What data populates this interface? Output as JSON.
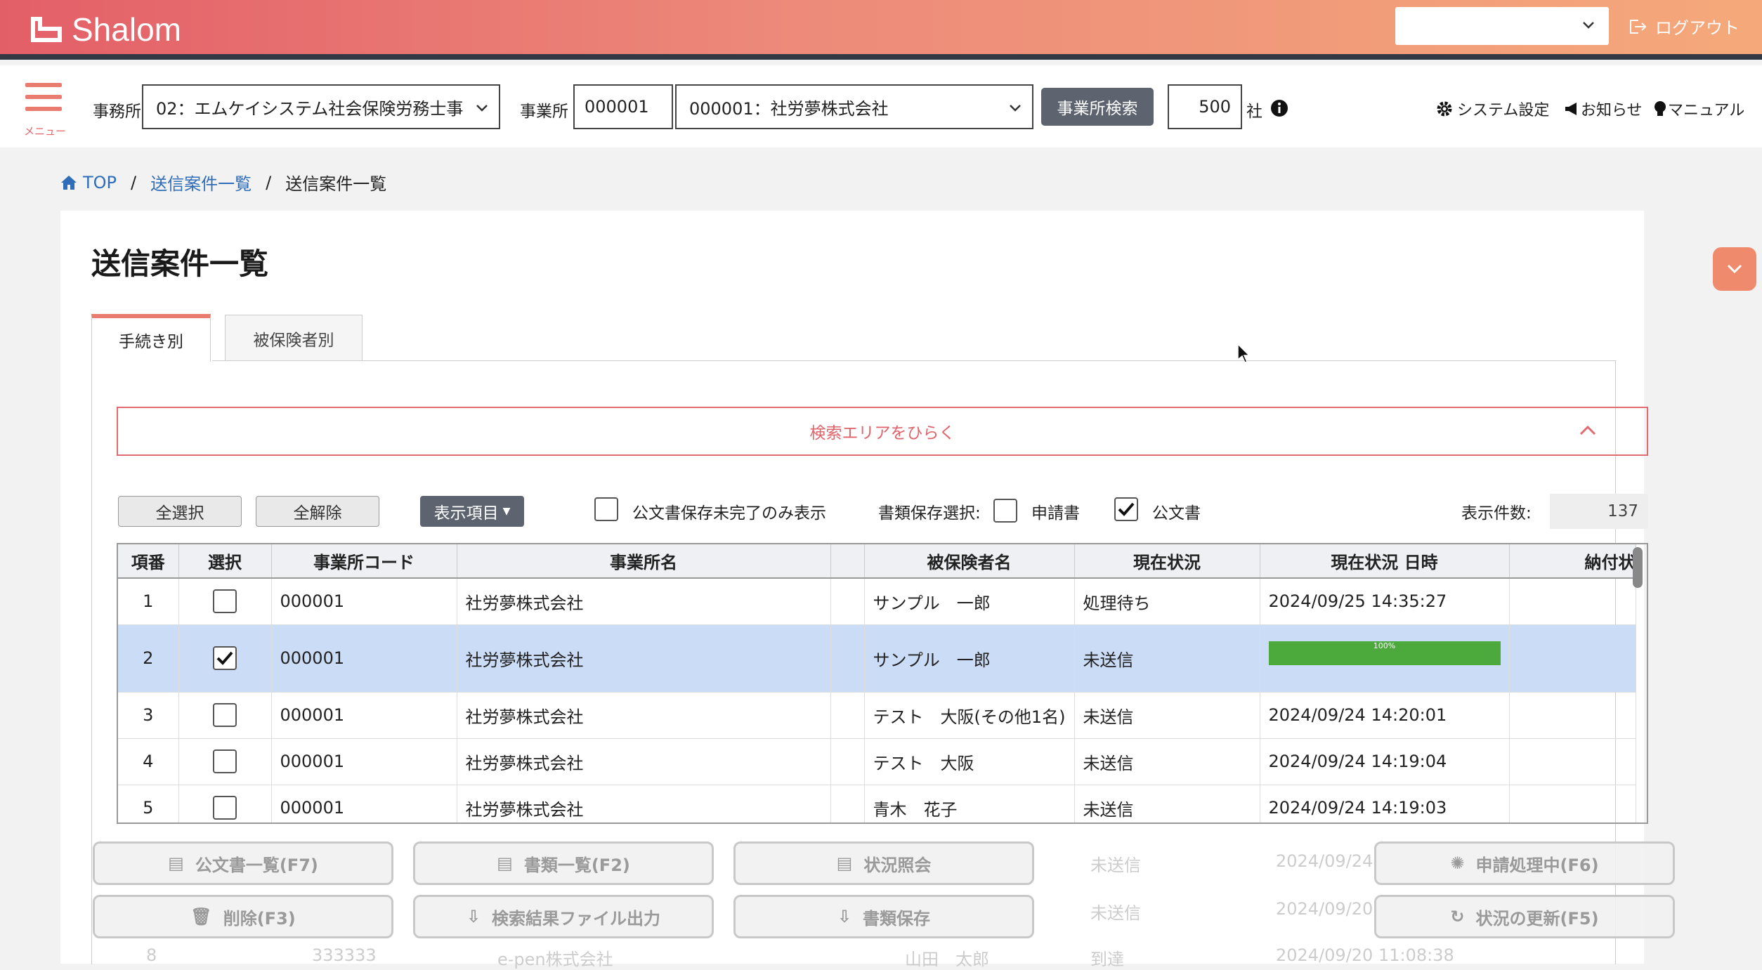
{
  "header": {
    "app_name": "Shalom",
    "account_select_value": "",
    "logout_label": "ログアウト"
  },
  "subbar": {
    "menu_label": "メニュー",
    "office_label": "事務所",
    "office_value": "02：エムケイシステム社会保険労務士事",
    "branch_label": "事業所",
    "branch_code": "000001",
    "branch_value": "000001：社労夢株式会社",
    "branch_search_button": "事業所検索",
    "company_count": "500",
    "company_unit": "社",
    "system_settings": "システム設定",
    "notices": "お知らせ",
    "manual": "マニュアル"
  },
  "breadcrumb": {
    "top": "TOP",
    "level1": "送信案件一覧",
    "current": "送信案件一覧"
  },
  "page": {
    "title": "送信案件一覧",
    "tabs": [
      "手続き別",
      "被保険者別"
    ],
    "search_area_label": "検索エリアをひらく"
  },
  "toolbar": {
    "select_all": "全選択",
    "deselect_all": "全解除",
    "display_items": "表示項目",
    "only_incomplete_label": "公文書保存未完了のみ表示",
    "doc_save_label": "書類保存選択:",
    "application_label": "申請書",
    "official_doc_label": "公文書",
    "display_count_label": "表示件数:",
    "display_count_value": "137"
  },
  "table": {
    "headers": [
      "項番",
      "選択",
      "事業所コード",
      "事業所名",
      "",
      "被保険者名",
      "現在状況",
      "現在状況 日時",
      "納付状"
    ],
    "rows": [
      {
        "no": "1",
        "checked": false,
        "code": "000001",
        "name": "社労夢株式会社",
        "person": "サンプル　一郎",
        "status": "処理待ち",
        "datetime": "2024/09/25 14:35:27",
        "progress": null
      },
      {
        "no": "2",
        "checked": true,
        "code": "000001",
        "name": "社労夢株式会社",
        "person": "サンプル　一郎",
        "status": "未送信",
        "datetime": "",
        "progress": "100%"
      },
      {
        "no": "3",
        "checked": false,
        "code": "000001",
        "name": "社労夢株式会社",
        "person": "テスト　大阪(その他1名)",
        "status": "未送信",
        "datetime": "2024/09/24 14:20:01",
        "progress": null
      },
      {
        "no": "4",
        "checked": false,
        "code": "000001",
        "name": "社労夢株式会社",
        "person": "テスト　大阪",
        "status": "未送信",
        "datetime": "2024/09/24 14:19:04",
        "progress": null
      },
      {
        "no": "5",
        "checked": false,
        "code": "000001",
        "name": "社労夢株式会社",
        "person": "青木　花子",
        "status": "未送信",
        "datetime": "2024/09/24 14:19:03",
        "progress": null
      }
    ],
    "ghost_rows": [
      {
        "status": "未送信",
        "datetime": "2024/09/24"
      },
      {
        "status": "未送信",
        "datetime": "2024/09/20"
      },
      {
        "no": "8",
        "code": "333333",
        "name": "e-pen株式会社",
        "person": "山田　太郎",
        "status": "到達",
        "datetime": "2024/09/20 11:08:38"
      }
    ]
  },
  "footer_buttons": {
    "official_docs": "公文書一覧(F7)",
    "documents": "書類一覧(F2)",
    "status_inquiry": "状況照会",
    "applying": "申請処理中(F6)",
    "delete": "削除(F3)",
    "export": "検索結果ファイル出力",
    "save_docs": "書類保存",
    "refresh": "状況の更新(F5)"
  },
  "colors": {
    "accent": "#ea7b6f",
    "header_gradient_start": "#e35f68",
    "header_gradient_end": "#f5a97a",
    "selected_row": "#cbdcf7",
    "progress": "#4caa3c",
    "link": "#2f6db8"
  }
}
